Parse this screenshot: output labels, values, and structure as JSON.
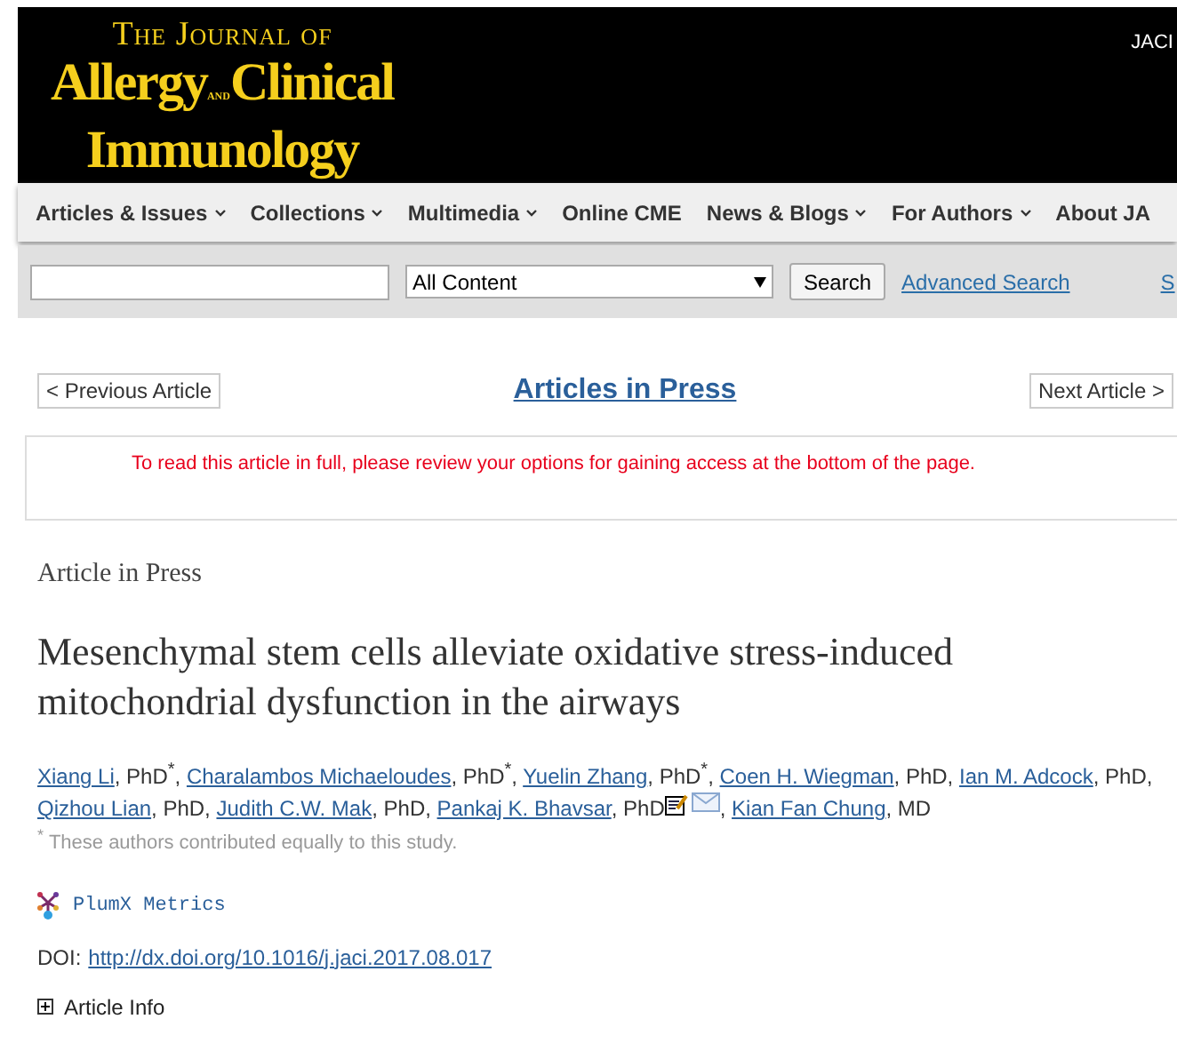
{
  "header": {
    "logo_top": "The Journal of",
    "logo_main_1": "Allergy",
    "logo_and": "and",
    "logo_main_2": "Clinical",
    "logo_bottom": "Immunology",
    "corner_text": "JACI"
  },
  "nav": [
    {
      "label": "Articles & Issues",
      "dropdown": true
    },
    {
      "label": "Collections",
      "dropdown": true
    },
    {
      "label": "Multimedia",
      "dropdown": true
    },
    {
      "label": "Online CME",
      "dropdown": false
    },
    {
      "label": "News & Blogs",
      "dropdown": true
    },
    {
      "label": "For Authors",
      "dropdown": true
    },
    {
      "label": "About JA",
      "dropdown": false
    }
  ],
  "search": {
    "scope": "All Content",
    "button": "Search",
    "advanced": "Advanced Search",
    "edge_link": "S"
  },
  "pager": {
    "previous": "< Previous Article",
    "center": "Articles in Press",
    "next": "Next Article >"
  },
  "notice": "To read this article in full, please review your options for gaining access at the bottom of the page.",
  "article": {
    "label": "Article in Press",
    "title": "Mesenchymal stem cells alleviate oxidative stress-induced mitochondrial dysfunction in the airways",
    "authors": [
      {
        "name": "Xiang Li",
        "suffix": ", PhD$^{*}$, "
      },
      {
        "name": "Charalambos Michaeloudes",
        "suffix": ", PhD$^{*}$, "
      },
      {
        "name": "Yuelin Zhang",
        "suffix": ", PhD$^{*}$, "
      },
      {
        "name": "Coen H. Wiegman",
        "suffix": ", PhD, "
      },
      {
        "name": "Ian M. Adcock",
        "suffix": ", PhD, "
      },
      {
        "name": "Qizhou Lian",
        "suffix": ", PhD, "
      },
      {
        "name": "Judith C.W. Mak",
        "suffix": ", PhD, "
      },
      {
        "name": "Pankaj K. Bhavsar",
        "suffix": ", PhD",
        "contact_icons": true,
        "after": ", "
      },
      {
        "name": "Kian Fan Chung",
        "suffix": ", MD"
      }
    ],
    "footnote_mark": "*",
    "footnote": "These authors contributed equally to this study.",
    "metrics": "PlumX Metrics",
    "doi_label": "DOI:",
    "doi": "http://dx.doi.org/10.1016/j.jaci.2017.08.017",
    "info": "Article Info",
    "info_expanded": false
  }
}
